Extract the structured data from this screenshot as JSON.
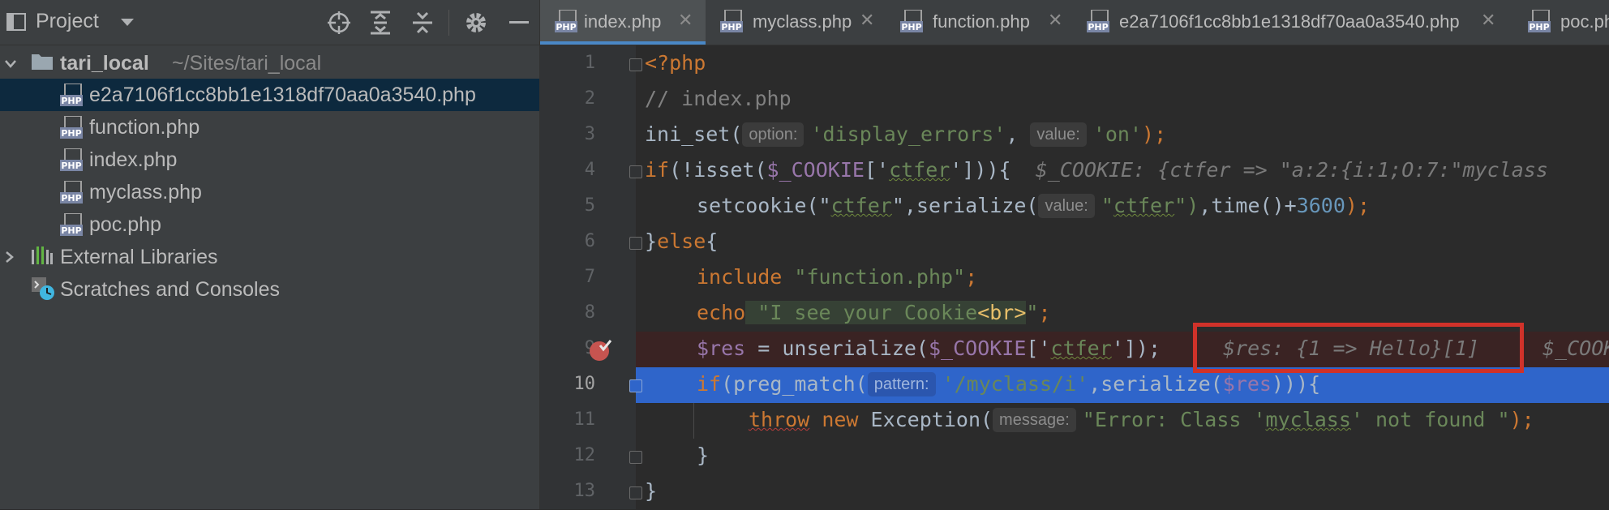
{
  "project": {
    "title": "Project",
    "root": {
      "name": "tari_local",
      "path": "~/Sites/tari_local"
    },
    "files": [
      "e2a7106f1cc8bb1e1318df70aa0a3540.php",
      "function.php",
      "index.php",
      "myclass.php",
      "poc.php"
    ],
    "external_libraries": "External Libraries",
    "scratches": "Scratches and Consoles"
  },
  "tabs": [
    {
      "label": "index.php",
      "active": true
    },
    {
      "label": "myclass.php"
    },
    {
      "label": "function.php"
    },
    {
      "label": "e2a7106f1cc8bb1e1318df70aa0a3540.php"
    },
    {
      "label": "poc.php"
    }
  ],
  "icon_text": {
    "php": "PHP"
  },
  "code": {
    "line_numbers": [
      "1",
      "2",
      "3",
      "4",
      "5",
      "6",
      "7",
      "8",
      "9",
      "10",
      "11",
      "12",
      "13"
    ],
    "l1_open": "<?php",
    "l2_comment": "// index.php",
    "l3": {
      "fn": "ini_set(",
      "hint1": "option:",
      "arg1": "'display_errors'",
      "comma": ", ",
      "hint2": "value:",
      "arg2": "'on'",
      "end": ");"
    },
    "l4": {
      "kw": "if",
      "a": "(!isset(",
      "var": "$_COOKIE",
      "b": "['",
      "key": "ctfer",
      "c": "'])){",
      "debug": "  $_COOKIE: {ctfer => \"a:2:{i:1;O:7:\"myclass"
    },
    "l5": {
      "a": "setcookie(\"",
      "s1": "ctfer",
      "b": "\",serialize(",
      "hint": "value:",
      "c": "\"",
      "s2": "ctfer",
      "d": "\")",
      "e": ",time()+",
      "num": "3600",
      "f": ");"
    },
    "l6": {
      "a": "}",
      "kw": "else",
      "b": "{"
    },
    "l7": {
      "kw": "include",
      "str": " \"function.php\"",
      "end": ";"
    },
    "l8": {
      "kw": "echo",
      "s1": " \"I see your Cookie",
      "tag": "<br>",
      "s2": "\"",
      "end": ";"
    },
    "l9": {
      "var": "$res",
      "a": " = unserialize(",
      "var2": "$_COOKIE",
      "b": "['",
      "key": "ctfer",
      "c": "']);",
      "debug1": "$res: {1 => Hello}[1]",
      "debug2": "$_COOK"
    },
    "l10": {
      "kw": "if",
      "a": "(preg_match(",
      "hint": "pattern:",
      "str": "'/myclass/i'",
      "b": ",serialize(",
      "var": "$res",
      "c": "))){"
    },
    "l11": {
      "kw": "throw",
      "kw2": " new ",
      "a": "Exception(",
      "hint": "message:",
      "s1": "\"Error: Class '",
      "s2": "myclass",
      "s3": "' not found \"",
      "end": ");"
    },
    "l12": "}",
    "l13": "}"
  },
  "colors": {
    "selection_line": "#2f65ca",
    "breakpoint_line": "#3a2323",
    "highlight_box": "#d0322a"
  }
}
